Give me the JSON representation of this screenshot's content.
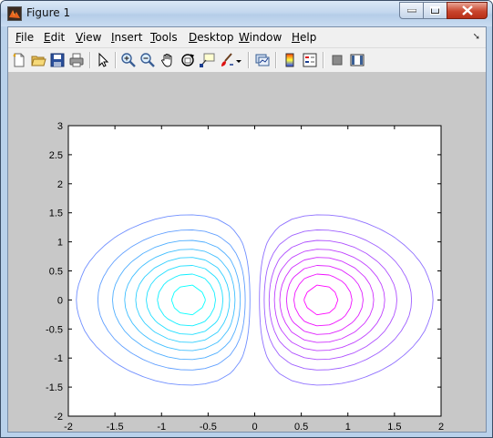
{
  "window": {
    "title": "Figure 1"
  },
  "menu": [
    {
      "underline": "F",
      "rest": "ile"
    },
    {
      "underline": "E",
      "rest": "dit"
    },
    {
      "underline": "V",
      "rest": "iew"
    },
    {
      "underline": "I",
      "rest": "nsert"
    },
    {
      "underline": "T",
      "rest": "ools"
    },
    {
      "underline": "D",
      "rest": "esktop"
    },
    {
      "underline": "W",
      "rest": "indow"
    },
    {
      "underline": "H",
      "rest": "elp"
    }
  ],
  "toolbar_icons": [
    "new-figure-icon",
    "open-file-icon",
    "save-icon",
    "print-icon",
    "pointer-icon",
    "zoom-in-icon",
    "zoom-out-icon",
    "pan-hand-icon",
    "rotate-3d-icon",
    "data-cursor-icon",
    "brush-icon",
    "brush-dropdown-icon",
    "link-plot-icon",
    "colorbar-icon",
    "legend-icon",
    "hide-plot-tools-icon",
    "show-plot-tools-icon"
  ],
  "chart_data": {
    "type": "contour",
    "function": "z = x * exp(-x^2 - y^2)",
    "levels": [
      -0.4,
      -0.35,
      -0.3,
      -0.25,
      -0.2,
      -0.15,
      -0.1,
      -0.05,
      0.05,
      0.1,
      0.15,
      0.2,
      0.25,
      0.3,
      0.35,
      0.4
    ],
    "colormap": "cool",
    "xlim": [
      -2,
      2
    ],
    "ylim": [
      -2,
      3
    ],
    "xticks": [
      -2,
      -1.5,
      -1,
      -0.5,
      0,
      0.5,
      1,
      1.5,
      2
    ],
    "xtick_labels": [
      "-2",
      "-1.5",
      "-1",
      "-0.5",
      "0",
      "0.5",
      "1",
      "1.5",
      "2"
    ],
    "yticks": [
      -2,
      -1.5,
      -1,
      -0.5,
      0,
      0.5,
      1,
      1.5,
      2,
      2.5,
      3
    ],
    "ytick_labels": [
      "-2",
      "-1.5",
      "-1",
      "-0.5",
      "0",
      "0.5",
      "1",
      "1.5",
      "2",
      "2.5",
      "3"
    ],
    "grid": false
  }
}
